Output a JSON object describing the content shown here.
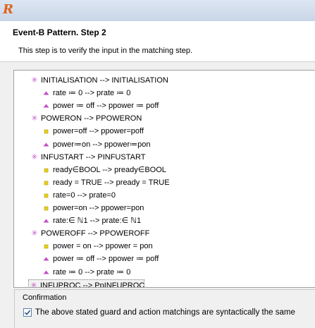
{
  "app": {
    "logo_text": "R",
    "logo_color": "#e0631c"
  },
  "header": {
    "title": "Event-B Pattern. Step 2",
    "description": "This step is to verify the input in the matching step."
  },
  "tree": {
    "rows": [
      {
        "label": "INITIALISATION --> INITIALISATION",
        "icon": "star-icon",
        "level": 0
      },
      {
        "label": "rate ≔ 0 --> prate ≔ 0",
        "icon": "action-triangle-icon",
        "level": 1
      },
      {
        "label": "power ≔ off --> ppower ≔ poff",
        "icon": "action-triangle-icon",
        "level": 1
      },
      {
        "label": "POWERON --> PPOWERON",
        "icon": "star-icon",
        "level": 0
      },
      {
        "label": "power=off --> ppower=poff",
        "icon": "guard-square-icon",
        "level": 1
      },
      {
        "label": "power≔on --> ppower≔pon",
        "icon": "action-triangle-icon",
        "level": 1
      },
      {
        "label": "INFUSTART --> PINFUSTART",
        "icon": "star-icon",
        "level": 0
      },
      {
        "label": "ready∈BOOL --> pready∈BOOL",
        "icon": "guard-square-icon",
        "level": 1
      },
      {
        "label": "ready = TRUE --> pready = TRUE",
        "icon": "guard-square-icon",
        "level": 1
      },
      {
        "label": "rate=0 --> prate=0",
        "icon": "guard-square-icon",
        "level": 1
      },
      {
        "label": "power=on --> ppower=pon",
        "icon": "guard-square-icon",
        "level": 1
      },
      {
        "label": "rate:∈ ℕ1 --> prate:∈ ℕ1",
        "icon": "action-triangle-icon",
        "level": 1
      },
      {
        "label": "POWEROFF  --> PPOWEROFF",
        "icon": "star-icon",
        "level": 0
      },
      {
        "label": "power = on --> ppower = pon",
        "icon": "guard-square-icon",
        "level": 1
      },
      {
        "label": "power ≔ off --> ppower ≔ poff",
        "icon": "action-triangle-icon",
        "level": 1
      },
      {
        "label": "rate ≔ 0 --> prate ≔ 0",
        "icon": "action-triangle-icon",
        "level": 1
      },
      {
        "label": "INFUPROC --> PpINFUPROC",
        "icon": "star-icon",
        "level": 0,
        "selected": true
      }
    ]
  },
  "confirmation": {
    "group_label": "Confirmation",
    "checkbox_label": "The above stated guard and action matchings are syntactically the same",
    "checked": true
  },
  "colors": {
    "event_star": "#c45cc7",
    "guard_square": "#e8d21c",
    "action_triangle": "#c24fc5"
  }
}
